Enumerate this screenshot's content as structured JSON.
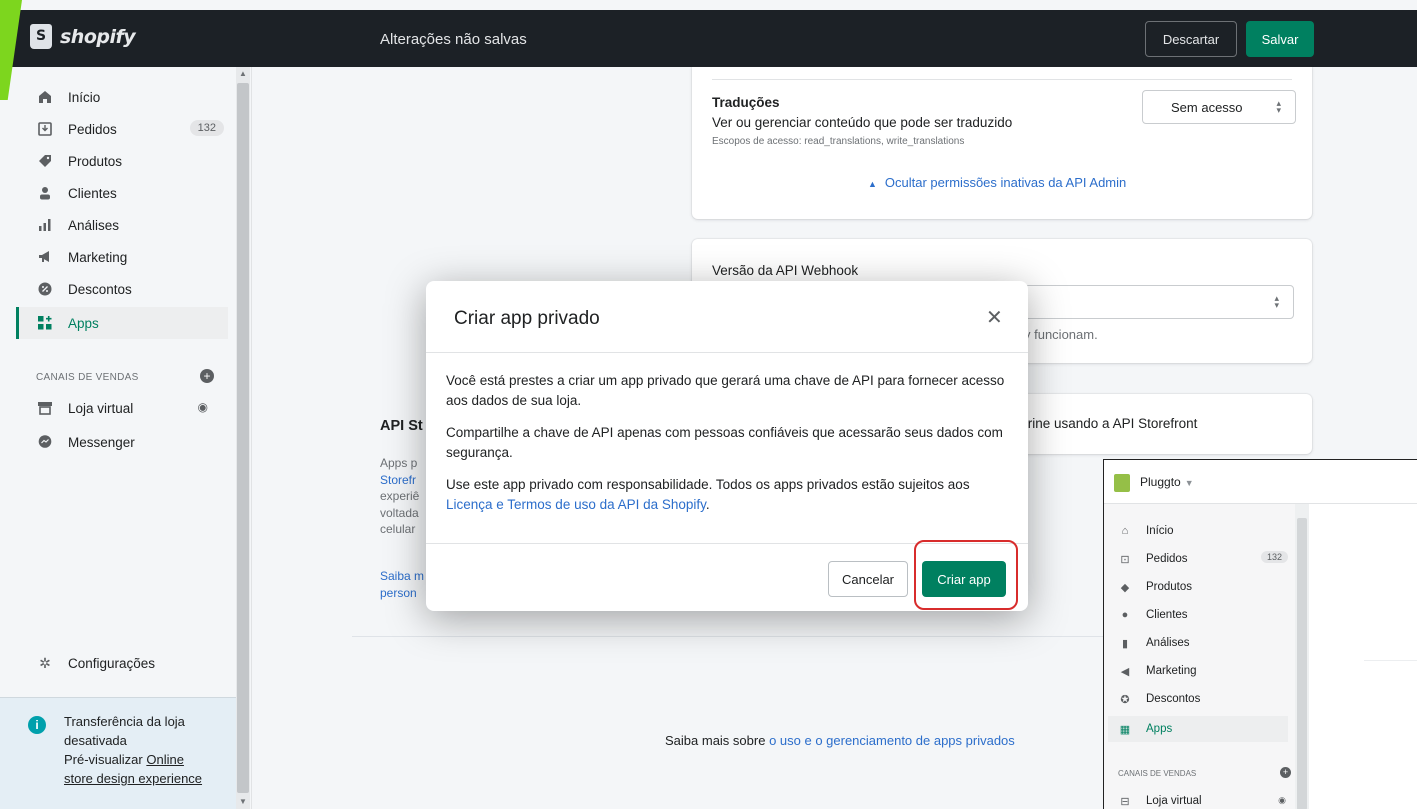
{
  "header": {
    "logo_text": "shopify",
    "status": "Alterações não salvas",
    "discard_label": "Descartar",
    "save_label": "Salvar"
  },
  "sidebar": {
    "items": [
      {
        "label": "Início",
        "icon": "home-icon"
      },
      {
        "label": "Pedidos",
        "icon": "orders-icon",
        "badge": "132"
      },
      {
        "label": "Produtos",
        "icon": "tag-icon"
      },
      {
        "label": "Clientes",
        "icon": "person-icon"
      },
      {
        "label": "Análises",
        "icon": "bar-chart-icon"
      },
      {
        "label": "Marketing",
        "icon": "megaphone-icon"
      },
      {
        "label": "Descontos",
        "icon": "discount-icon"
      },
      {
        "label": "Apps",
        "icon": "apps-icon",
        "active": true
      }
    ],
    "sales_channels_label": "CANAIS DE VENDAS",
    "channels": [
      {
        "label": "Loja virtual",
        "icon": "store-icon"
      },
      {
        "label": "Messenger",
        "icon": "messenger-icon"
      }
    ],
    "settings_label": "Configurações",
    "notice": {
      "line1": "Transferência da loja",
      "line2": "desativada",
      "line3_prefix": "Pré-visualizar ",
      "link1": "Online",
      "link2": "store design experience"
    }
  },
  "main": {
    "translations": {
      "title": "Traduções",
      "description": "Ver ou gerenciar conteúdo que pode ser traduzido",
      "scopes": "Escopos de acesso: read_translations, write_translations",
      "select_value": "Sem acesso"
    },
    "hide_inactive_link": "Ocultar permissões inativas da API Admin",
    "webhook": {
      "title": "Versão da API Webhook",
      "hint": "y funcionam."
    },
    "storefront_partial": "trine usando a API Storefront",
    "storefront_title": "API St",
    "storefront_desc": [
      "Apps p",
      "Storefr",
      "experiê",
      "voltada",
      "celular"
    ],
    "storefront_links": [
      "Saiba m",
      "person"
    ],
    "learn_more_prefix": "Saiba mais sobre ",
    "learn_more_link": "o uso e o gerenciamento de apps privados"
  },
  "modal": {
    "title": "Criar app privado",
    "p1": "Você está prestes a criar um app privado que gerará uma chave de API para fornecer acesso aos dados de sua loja.",
    "p2": "Compartilhe a chave de API apenas com pessoas confiáveis que acessarão seus dados com segurança.",
    "p3_prefix": "Use este app privado com responsabilidade. Todos os apps privados estão sujeitos aos ",
    "p3_link": "Licença e Termos de uso da API da Shopify",
    "p3_suffix": ".",
    "cancel_label": "Cancelar",
    "create_label": "Criar app"
  },
  "inset": {
    "store_name": "Pluggto",
    "items": [
      {
        "label": "Início",
        "icon": "home-icon"
      },
      {
        "label": "Pedidos",
        "icon": "orders-icon",
        "badge": "132"
      },
      {
        "label": "Produtos",
        "icon": "tag-icon"
      },
      {
        "label": "Clientes",
        "icon": "person-icon"
      },
      {
        "label": "Análises",
        "icon": "bar-chart-icon"
      },
      {
        "label": "Marketing",
        "icon": "megaphone-icon"
      },
      {
        "label": "Descontos",
        "icon": "discount-icon"
      },
      {
        "label": "Apps",
        "icon": "apps-icon",
        "active": true
      }
    ],
    "sales_channels_label": "CANAIS DE VENDAS",
    "channel": "Loja virtual"
  },
  "colors": {
    "topbar": "#1c2126",
    "primary": "#008060",
    "link": "#2c6ecb",
    "highlight": "#d82c2c",
    "accent": "#7dd61e"
  }
}
